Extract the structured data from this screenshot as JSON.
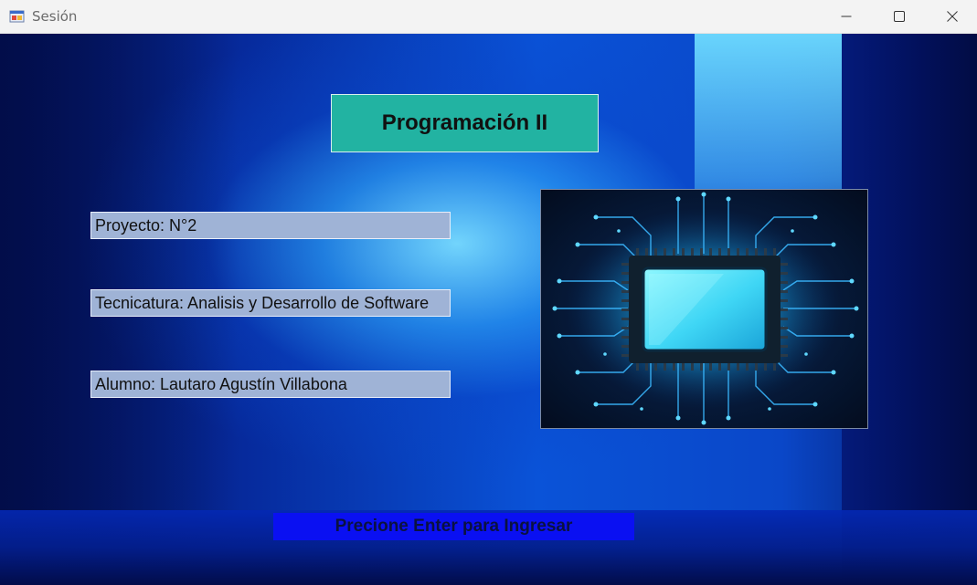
{
  "window": {
    "title": "Sesión",
    "controls": {
      "minimize": "minimize-icon",
      "maximize": "maximize-icon",
      "close": "close-icon"
    }
  },
  "header": {
    "title": "Programación II",
    "color": "#22b3a2"
  },
  "info": {
    "proyecto": "Proyecto: N°2",
    "tecnicatura": "Tecnicatura: Analisis y Desarrollo de Software",
    "alumno": "Alumno: Lautaro Agustín Villabona"
  },
  "image": {
    "subject": "microchip-circuit-icon"
  },
  "prompt": {
    "text": "Precione Enter para Ingresar",
    "color": "#0a10f2"
  }
}
